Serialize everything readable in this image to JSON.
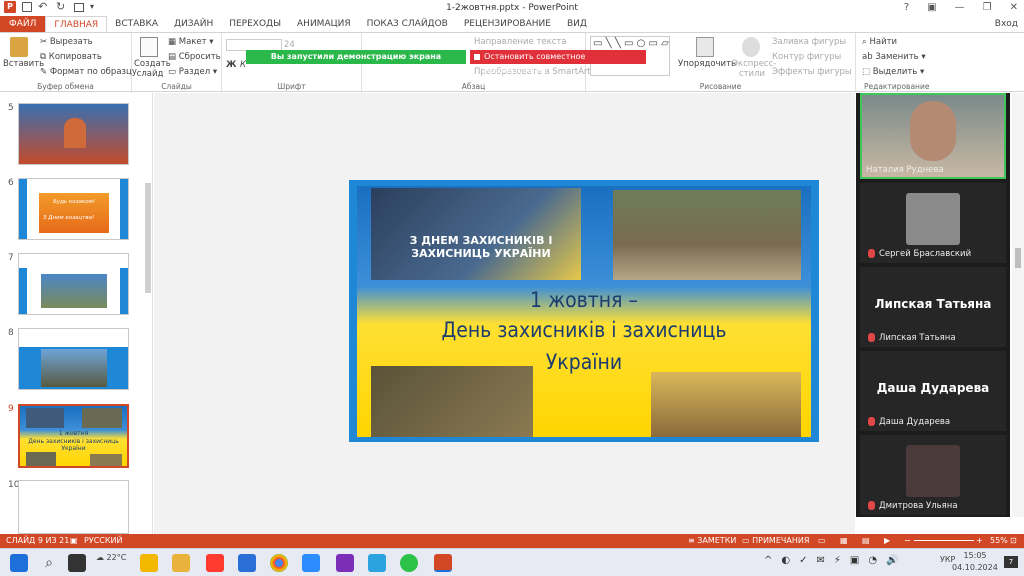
{
  "window": {
    "title": "1-2жовтня.pptx - PowerPoint",
    "help": "?",
    "signin": "Вход"
  },
  "tabs": [
    "ФАЙЛ",
    "ГЛАВНАЯ",
    "ВСТАВКА",
    "ДИЗАЙН",
    "ПЕРЕХОДЫ",
    "АНИМАЦИЯ",
    "ПОКАЗ СЛАЙДОВ",
    "РЕЦЕНЗИРОВАНИЕ",
    "ВИД"
  ],
  "ribbon": {
    "clipboard": {
      "paste": "Вставить",
      "cut": "Вырезать",
      "copy": "Копировать",
      "format": "Формат по образцу",
      "label": "Буфер обмена"
    },
    "slides": {
      "create": "Создать слайд",
      "layout": "Макет",
      "reset": "Сбросить",
      "section": "Раздел",
      "label": "Слайды"
    },
    "font": {
      "size": "24",
      "label": "Шрифт"
    },
    "paragraph": {
      "text_direction": "Направление текста",
      "smartart": "Преобразовать в SmartArt",
      "label": "Абзац"
    },
    "drawing": {
      "arrange": "Упорядочить",
      "quick_styles": "Экспресс-стили",
      "fill": "Заливка фигуры",
      "outline": "Контур фигуры",
      "effects": "Эффекты фигуры",
      "label": "Рисование"
    },
    "editing": {
      "find": "Найти",
      "replace": "Заменить",
      "select": "Выделить",
      "label": "Редактирование"
    }
  },
  "share_banner": {
    "started": "Вы запустили демонстрацию экрана",
    "stop": "Остановить совместное использование"
  },
  "thumbnails": [
    {
      "num": "5",
      "selected": false
    },
    {
      "num": "6",
      "selected": false,
      "text1": "Будь козаком!",
      "text2": "З Днем козацтва!"
    },
    {
      "num": "7",
      "selected": false
    },
    {
      "num": "8",
      "selected": false
    },
    {
      "num": "9",
      "selected": true,
      "text1": "1 жовтня",
      "text2": "День захисників і захисниць України"
    },
    {
      "num": "10",
      "selected": false
    }
  ],
  "slide": {
    "banner": "З ДНЕМ ЗАХИСНИКІВ І ЗАХИСНИЦЬ УКРАЇНИ",
    "line1": "1 жовтня –",
    "line2": "День захисників і захисниць",
    "line3": "України"
  },
  "participants": {
    "p1": "Наталия Руднева",
    "p2": "Сергей Браславский",
    "p3_big": "Липская Татьяна",
    "p3": "Липская Татьяна",
    "p4_big": "Даша Дударева",
    "p4": "Даша Дударева",
    "p5": "Дмитрова Ульяна"
  },
  "status": {
    "slide": "СЛАЙД 9 ИЗ 21",
    "lang": "РУССКИЙ",
    "notes": "ЗАМЕТКИ",
    "comments": "ПРИМЕЧАНИЯ",
    "zoom": "55%"
  },
  "taskbar": {
    "temp": "22°C",
    "time": "15:05",
    "date": "04.10.2024",
    "lang": "УКР"
  },
  "colors": {
    "accent": "#d24726",
    "green": "#2ab84b",
    "red": "#e0313a"
  }
}
